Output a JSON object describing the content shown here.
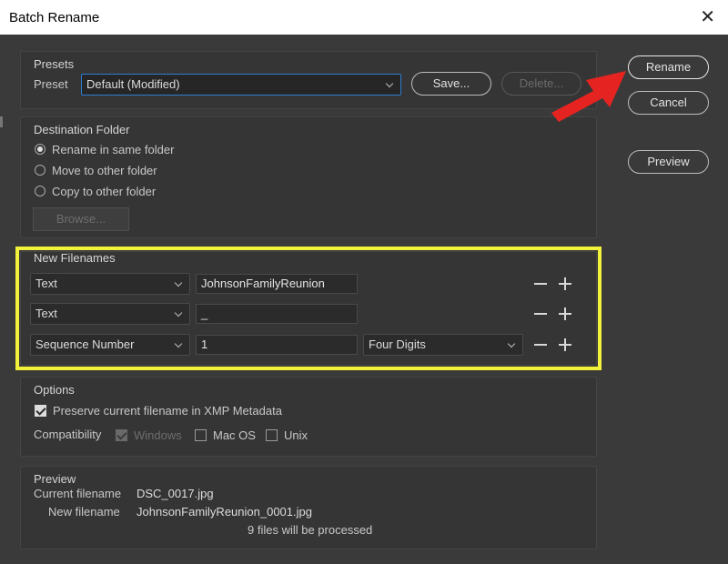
{
  "window": {
    "title": "Batch Rename"
  },
  "actions": {
    "rename": "Rename",
    "cancel": "Cancel",
    "preview": "Preview"
  },
  "presets": {
    "section_title": "Presets",
    "preset_label": "Preset",
    "preset_value": "Default (Modified)",
    "save_label": "Save...",
    "delete_label": "Delete..."
  },
  "destination": {
    "section_title": "Destination Folder",
    "options": [
      "Rename in same folder",
      "Move to other folder",
      "Copy to other folder"
    ],
    "selected_index": 0,
    "browse_label": "Browse..."
  },
  "new_filenames": {
    "section_title": "New Filenames",
    "rows": [
      {
        "type": "Text",
        "value": "JohnsonFamilyReunion"
      },
      {
        "type": "Text",
        "value": "_"
      },
      {
        "type": "Sequence Number",
        "value": "1",
        "digits": "Four Digits"
      }
    ]
  },
  "options": {
    "section_title": "Options",
    "preserve_label": "Preserve current filename in XMP Metadata",
    "preserve_checked": true,
    "compatibility_label": "Compatibility",
    "compat": [
      {
        "label": "Windows",
        "checked": true,
        "disabled": true
      },
      {
        "label": "Mac OS",
        "checked": false,
        "disabled": false
      },
      {
        "label": "Unix",
        "checked": false,
        "disabled": false
      }
    ]
  },
  "preview_section": {
    "section_title": "Preview",
    "current_label": "Current filename",
    "current_value": "DSC_0017.jpg",
    "new_label": "New filename",
    "new_value": "JohnsonFamilyReunion_0001.jpg",
    "status": "9 files will be processed"
  },
  "colors": {
    "highlight": "#f2f23a",
    "arrow": "#e52421",
    "focus": "#2d7dd2",
    "dialog_bg": "#3a3a3a"
  },
  "icons": {
    "close": "close-icon",
    "dropdown": "chevron-down-icon",
    "remove": "minus-icon",
    "add": "plus-icon"
  }
}
